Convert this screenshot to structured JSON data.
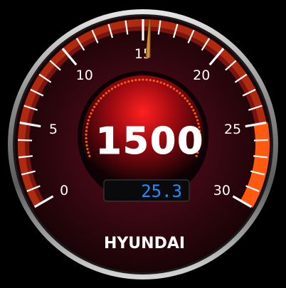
{
  "gauge": {
    "scale_labels": [
      "0",
      "5",
      "10",
      "15",
      "20",
      "25",
      "30"
    ],
    "scale_min": 0,
    "scale_max": 30,
    "needle_value": 15.4,
    "redline_start": 25,
    "rpm_readout": "1500",
    "secondary_readout": "25.3",
    "brand": "HYUNDAI",
    "colors": {
      "background": "#000000",
      "face": "#3a0810",
      "accent": "#ff5a10",
      "redline": "#ff5a10",
      "lcd_text": "#1e90ff",
      "readout_text": "#ffffff",
      "needle": "#c97a20"
    }
  }
}
